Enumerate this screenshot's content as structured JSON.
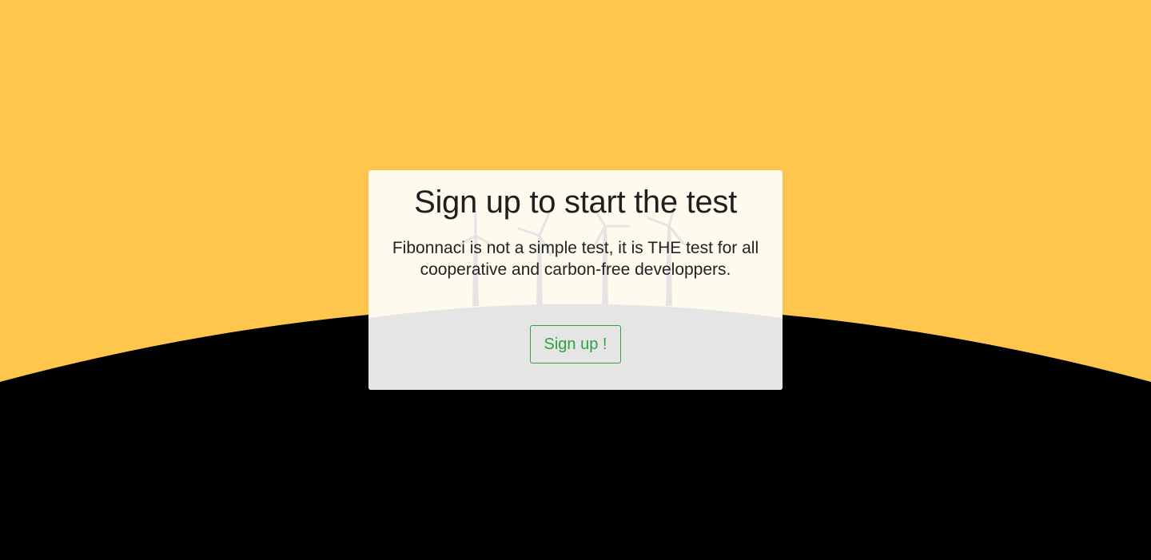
{
  "page": {
    "colors": {
      "sky": "#ffc64e",
      "ground": "#000000",
      "card_upper": "#fefaed",
      "card_lower": "#e5e5e5",
      "button_accent": "#2aa53e"
    }
  },
  "signup_card": {
    "title": "Sign up to start the test",
    "description": "Fibonnaci is not a simple test, it is THE test for all cooperative and carbon-free developpers.",
    "decoration_icon": "wind-turbines-icon",
    "button_label": "Sign up !"
  }
}
